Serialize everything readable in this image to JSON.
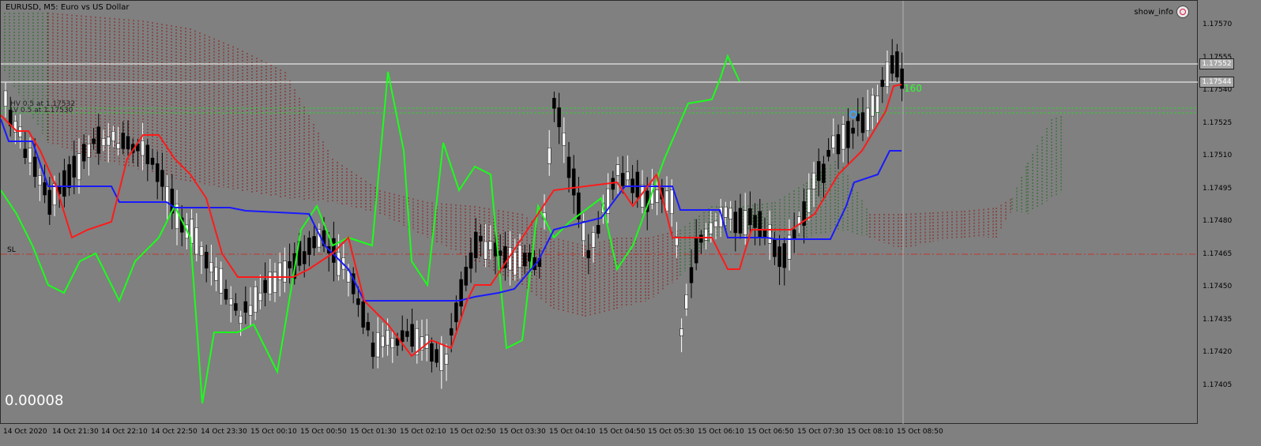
{
  "window": {
    "title": "EURUSD, M5:  Euro vs US Dollar",
    "show_info": "show_info",
    "big_value": "0.00008",
    "sl_label": "SL",
    "sl_hint": "HV 0.5 at 1.17532",
    "sl_hint2": "LV 0.5 at 1.17530",
    "indicator_badge": "160"
  },
  "price_axis": {
    "labels": [
      "1.17570",
      "1.17555",
      "1.17540",
      "1.17525",
      "1.17510",
      "1.17495",
      "1.17480",
      "1.17465",
      "1.17450",
      "1.17435",
      "1.17420",
      "1.17405"
    ],
    "bid": "1.17552",
    "ask": "1.17544"
  },
  "time_axis": {
    "labels": [
      "14 Oct 2020",
      "14 Oct 21:30",
      "14 Oct 22:10",
      "14 Oct 22:50",
      "14 Oct 23:30",
      "15 Oct 00:10",
      "15 Oct 00:50",
      "15 Oct 01:30",
      "15 Oct 02:10",
      "15 Oct 02:50",
      "15 Oct 03:30",
      "15 Oct 04:10",
      "15 Oct 04:50",
      "15 Oct 05:30",
      "15 Oct 06:10",
      "15 Oct 06:50",
      "15 Oct 07:30",
      "15 Oct 08:10",
      "15 Oct 08:50"
    ]
  },
  "colors": {
    "background": "#808080",
    "bull_candle": "#ffffff",
    "bear_candle": "#000000",
    "tenkan": "#ff1a1a",
    "kijun": "#1a1aff",
    "chikou": "#1aff1a",
    "cloud_bear": "#8b1a1a",
    "cloud_bull": "#1f6b1f",
    "sl_line": "#c0392b",
    "level_line": "#33cc33"
  }
}
